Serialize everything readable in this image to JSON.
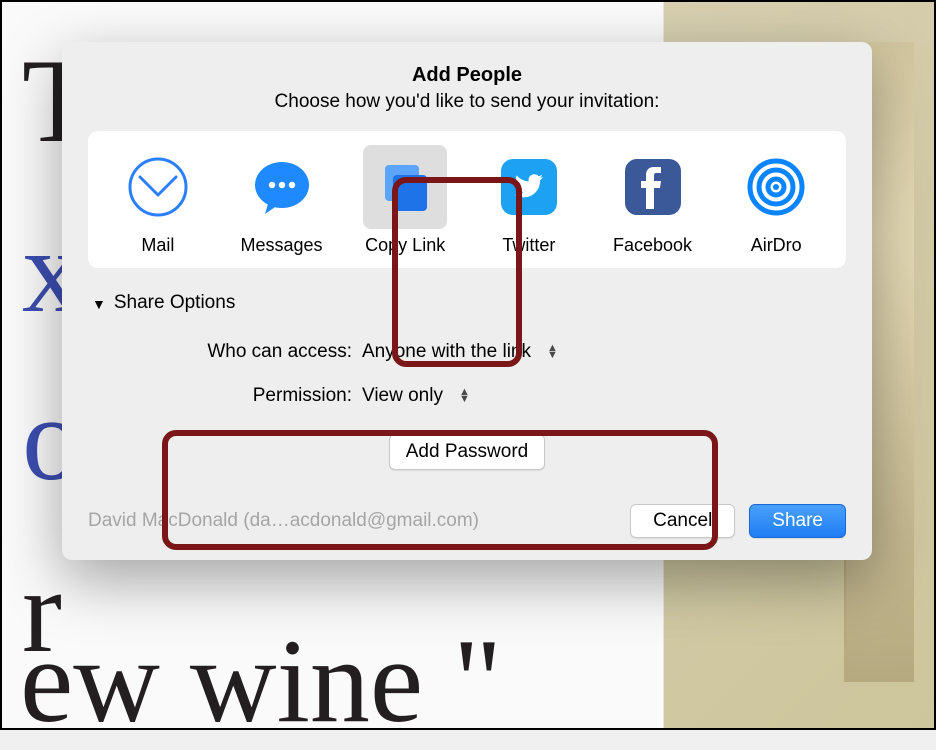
{
  "dialog": {
    "title": "Add People",
    "subtitle": "Choose how you'd like to send your invitation:"
  },
  "share_methods": [
    {
      "id": "mail",
      "label": "Mail",
      "icon": "mail-icon",
      "selected": false
    },
    {
      "id": "messages",
      "label": "Messages",
      "icon": "messages-icon",
      "selected": false
    },
    {
      "id": "copylink",
      "label": "Copy Link",
      "icon": "copylink-icon",
      "selected": true
    },
    {
      "id": "twitter",
      "label": "Twitter",
      "icon": "twitter-icon",
      "selected": false
    },
    {
      "id": "facebook",
      "label": "Facebook",
      "icon": "facebook-icon",
      "selected": false
    },
    {
      "id": "airdrop",
      "label": "AirDro",
      "icon": "airdrop-icon",
      "selected": false
    }
  ],
  "share_options": {
    "header": "Share Options",
    "who_label": "Who can access:",
    "who_value": "Anyone with the link",
    "permission_label": "Permission:",
    "permission_value": "View only",
    "add_password_label": "Add Password"
  },
  "footer": {
    "account_text": "David MacDonald (da…acdonald@gmail.com)",
    "cancel_label": "Cancel",
    "share_label": "Share"
  },
  "colors": {
    "highlight_border": "#7a1618",
    "primary_button": "#2f88f6"
  }
}
